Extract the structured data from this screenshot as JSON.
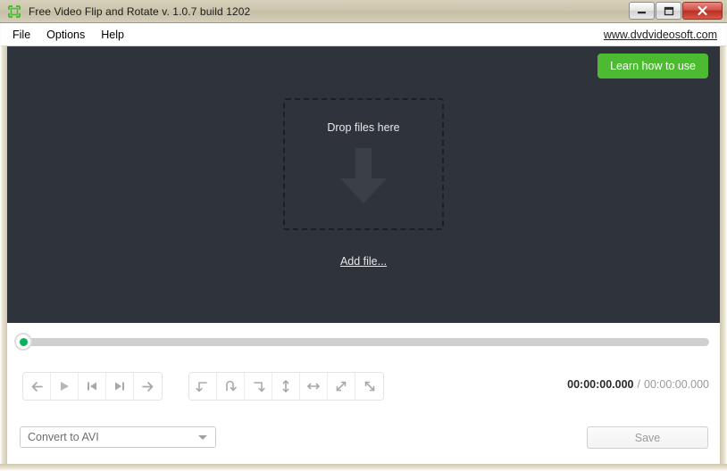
{
  "window": {
    "title": "Free Video Flip and Rotate v. 1.0.7 build 1202",
    "app_icon": "crop-frame-icon",
    "controls": {
      "minimize": "minimize-button",
      "maximize": "maximize-button",
      "close": "close-button"
    }
  },
  "menu": {
    "items": [
      {
        "label": "File"
      },
      {
        "label": "Options"
      },
      {
        "label": "Help"
      }
    ],
    "site_link": "www.dvdvideosoft.com"
  },
  "preview": {
    "learn_button": "Learn how to use",
    "dropzone_label": "Drop files here",
    "add_file_link": "Add file...",
    "arrow_icon": "down-arrow-icon",
    "background_color": "#2f333c"
  },
  "seek": {
    "value": 0,
    "thumb_color": "#05b358",
    "track_color": "#cfcfcf"
  },
  "playback_buttons": [
    {
      "name": "step-back-button",
      "icon": "arrow-left-icon"
    },
    {
      "name": "play-button",
      "icon": "play-icon"
    },
    {
      "name": "previous-frame-button",
      "icon": "skip-previous-icon"
    },
    {
      "name": "next-frame-button",
      "icon": "skip-next-icon"
    },
    {
      "name": "step-forward-button",
      "icon": "arrow-right-icon"
    }
  ],
  "transform_buttons": [
    {
      "name": "rotate-left-button",
      "icon": "rotate-counterclockwise-icon"
    },
    {
      "name": "rotate-180-button",
      "icon": "rotate-u-turn-icon"
    },
    {
      "name": "rotate-right-button",
      "icon": "rotate-clockwise-icon"
    },
    {
      "name": "flip-vertical-button",
      "icon": "arrow-up-down-icon"
    },
    {
      "name": "flip-horizontal-button",
      "icon": "arrow-left-right-icon"
    },
    {
      "name": "flip-diagonal-up-button",
      "icon": "arrow-diagonal-up-icon"
    },
    {
      "name": "flip-diagonal-down-button",
      "icon": "arrow-diagonal-down-icon"
    }
  ],
  "time": {
    "current": "00:00:00.000",
    "separator": "/",
    "total": "00:00:00.000"
  },
  "bottom": {
    "format_value": "Convert to AVI",
    "save_label": "Save"
  }
}
